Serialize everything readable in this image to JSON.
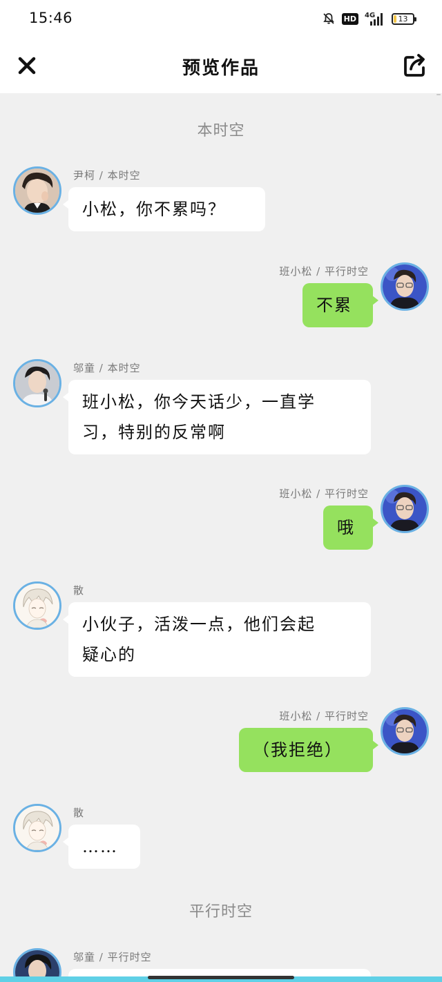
{
  "status_bar": {
    "time": "15:46",
    "icons": [
      "bell-off-icon",
      "hd-badge",
      "signal-4g-icon",
      "battery-icon"
    ],
    "hd_label": "HD",
    "network_label": "4G",
    "battery_level": "13",
    "battery_fraction": 0.13
  },
  "header": {
    "title": "预览作品",
    "close_icon": "close-icon",
    "share_icon": "share-icon"
  },
  "dividers": [
    "本时空",
    "平行时空"
  ],
  "messages": [
    {
      "side": "left",
      "name": "尹柯 / 本时空",
      "text": "小松，你不累吗？",
      "avatar": "avatar-yinke"
    },
    {
      "side": "right",
      "name": "班小松 / 平行时空",
      "text": "不累",
      "avatar": "avatar-banxiaosong"
    },
    {
      "side": "left",
      "name": "邬童 / 本时空",
      "text_lines": [
        "班小松，你今天话少，一直学",
        "习，特别的反常啊"
      ],
      "avatar": "avatar-wutong"
    },
    {
      "side": "right",
      "name": "班小松 / 平行时空",
      "text": "哦",
      "avatar": "avatar-banxiaosong"
    },
    {
      "side": "left",
      "name": "散",
      "text_lines": [
        "小伙子，活泼一点，他们会起",
        "疑心的"
      ],
      "avatar": "avatar-san"
    },
    {
      "side": "right",
      "name": "班小松 / 平行时空",
      "text": "（我拒绝）",
      "avatar": "avatar-banxiaosong"
    },
    {
      "side": "left",
      "name": "散",
      "text": "……",
      "avatar": "avatar-san"
    },
    {
      "side": "left",
      "name": "邬童 / 平行时空",
      "text": "",
      "avatar": "avatar-wutong-parallel"
    }
  ],
  "colors": {
    "background": "#f0f0f0",
    "header_background": "#ffffff",
    "left_bubble": "#ffffff",
    "right_bubble": "#95e15e",
    "avatar_ring": "#6ab1e4",
    "divider_text": "#8a8a8a",
    "name_text": "#777777"
  }
}
